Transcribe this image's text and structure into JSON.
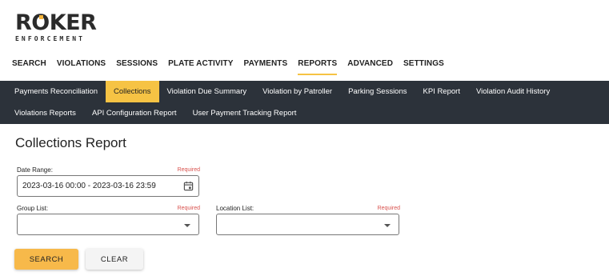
{
  "brand": {
    "logo_main": "ROKER",
    "logo_sub": "ENFORCEMENT",
    "accent_color": "#f6c344"
  },
  "main_nav": {
    "items": [
      "SEARCH",
      "VIOLATIONS",
      "SESSIONS",
      "PLATE ACTIVITY",
      "PAYMENTS",
      "REPORTS",
      "ADVANCED",
      "SETTINGS"
    ],
    "active": "REPORTS"
  },
  "sub_nav": {
    "row1": [
      "Payments Reconciliation",
      "Collections",
      "Violation Due Summary",
      "Violation by Patroller",
      "Parking Sessions",
      "KPI Report",
      "Violation Audit History"
    ],
    "row2": [
      "Violations Reports",
      "API Configuration Report",
      "User Payment Tracking Report"
    ],
    "active": "Collections"
  },
  "page": {
    "title": "Collections Report"
  },
  "form": {
    "date_range": {
      "label": "Date Range:",
      "required": "Required",
      "value": "2023-03-16 00:00 - 2023-03-16 23:59",
      "icon": "calendar-icon"
    },
    "group_list": {
      "label": "Group List:",
      "required": "Required",
      "value": ""
    },
    "location_list": {
      "label": "Location List:",
      "required": "Required",
      "value": ""
    },
    "search_label": "SEARCH",
    "clear_label": "CLEAR"
  }
}
